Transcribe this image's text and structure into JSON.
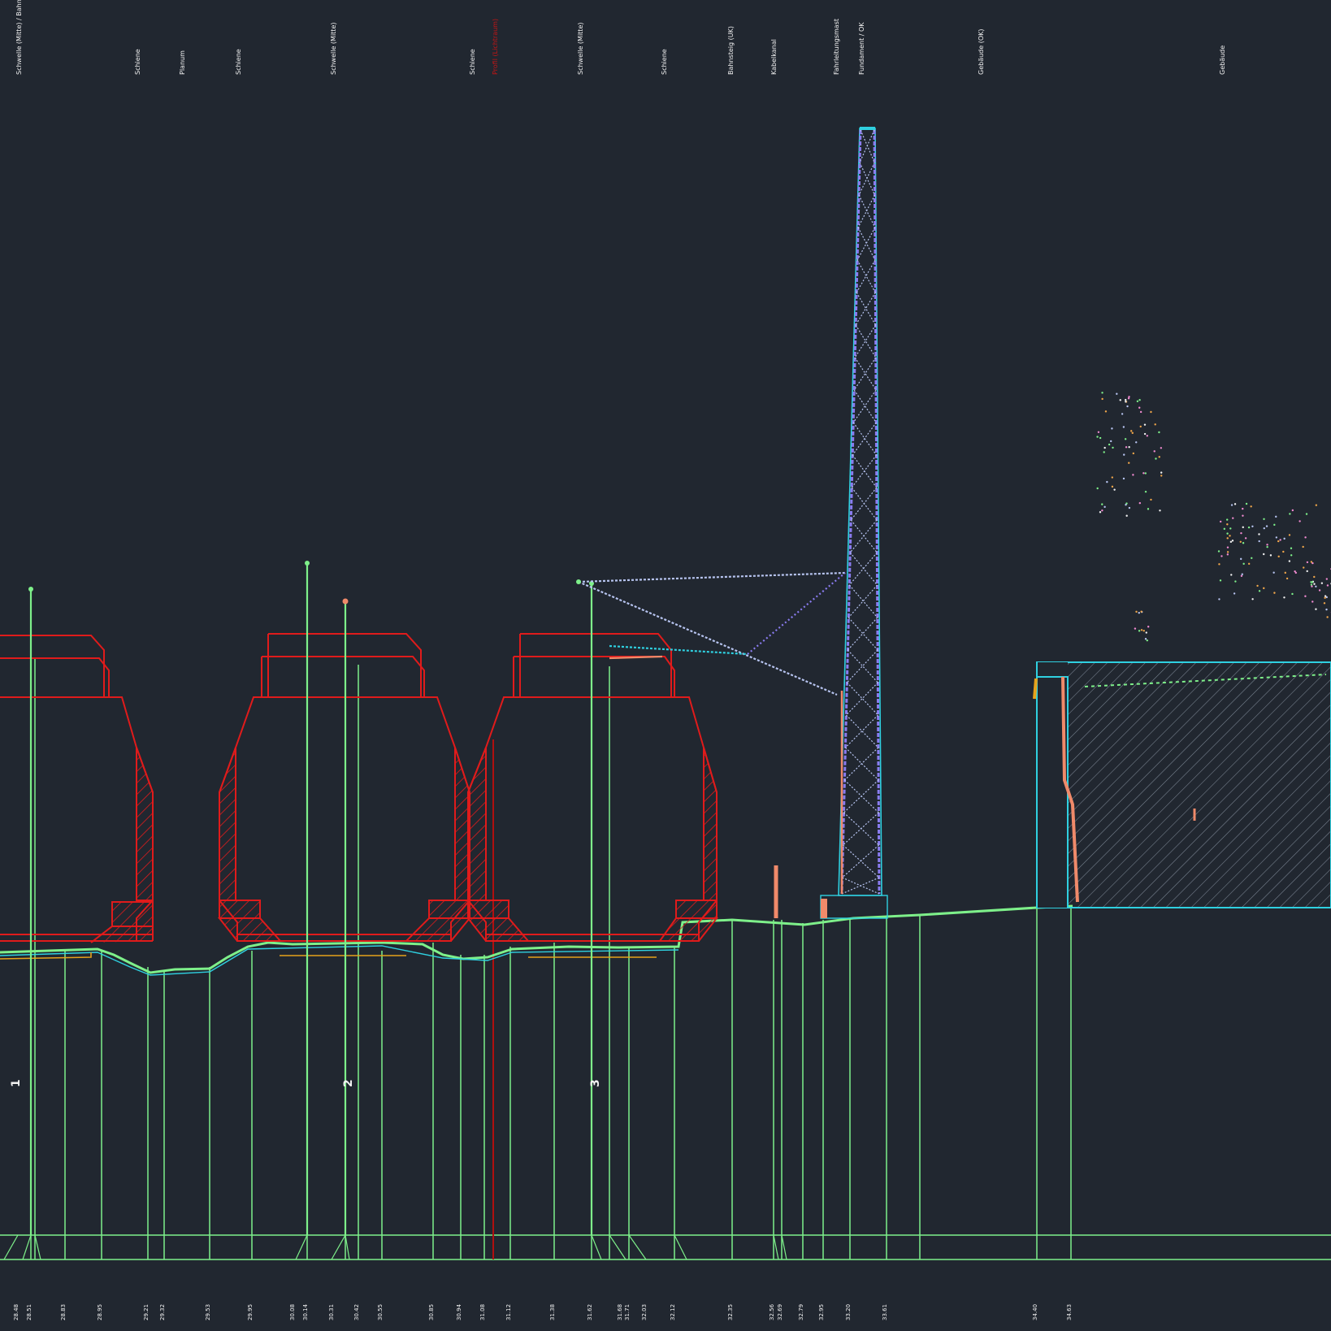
{
  "drawing": {
    "background": "#212730",
    "colors": {
      "vehicle": "#e01b1b",
      "ground": "#7ef08a",
      "structure": "#2fd0e0",
      "mast": "#8a7cf0",
      "text": "#f2f2f2",
      "grid": "#7ef08a",
      "hatch": "#8a96a4",
      "accent_red": "#b01010"
    },
    "top_labels": [
      "Schwelle (Mitte)\nBahnsteigkante",
      "Schiene",
      "Planum",
      "Schiene",
      "Schwelle (Mitte)",
      "Schiene",
      "Profil (Lichtraum)",
      "Schwelle (Mitte)",
      "Schiene",
      "Bahnsteig (UK)",
      "Kabelkanal",
      "Fahrleitungsmast",
      "Fundament\nOK",
      "Gebäude (OK)",
      "Gebäude"
    ],
    "track_marks": [
      "1",
      "2",
      "3"
    ],
    "bottom_labels": [
      "28.48",
      "28.51",
      "28.83",
      "28.95",
      "29.21",
      "29.32",
      "29.53",
      "29.95",
      "30.08",
      "30.14",
      "30.31",
      "30.42",
      "30.55",
      "30.85",
      "30.94",
      "31.08",
      "31.12",
      "31.38",
      "31.62",
      "31.68",
      "31.71",
      "32.03",
      "32.12",
      "32.35",
      "32.56",
      "32.69",
      "32.79",
      "32.95",
      "33.20",
      "33.61",
      "34.40",
      "34.63"
    ]
  }
}
